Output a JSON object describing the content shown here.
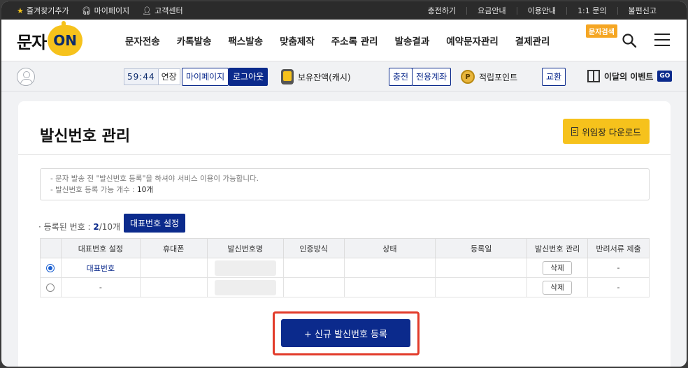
{
  "topbar": {
    "left": [
      "즐겨찾기추가",
      "마이페이지",
      "고객센터"
    ],
    "right": [
      "충전하기",
      "요금안내",
      "이용안내",
      "1:1 문의",
      "불편신고"
    ]
  },
  "header": {
    "logo_text": "문자",
    "logo_on": "ON",
    "nav": [
      "문자전송",
      "카톡발송",
      "팩스발송",
      "맞춤제작",
      "주소록 관리",
      "발송결과",
      "예약문자관리",
      "결제관리"
    ],
    "search_badge": "문자검색"
  },
  "userbar": {
    "timer": "59:44",
    "extend": "연장",
    "mypage": "마이페이지",
    "logout": "로그아웃",
    "balance": "보유잔액(캐시)",
    "charge": "충전",
    "dedicated": "전용계좌",
    "points": "적립포인트",
    "points_coin": "P",
    "exchange": "교환",
    "event": "이달의 이벤트",
    "go": "GO"
  },
  "page": {
    "title": "발신번호 관리",
    "download": "위임장 다운로드",
    "notice_1": "- 문자 발송 전 \"발신번호 등록\"을 하셔야 서비스 이용이 가능합니다.",
    "notice_2_prefix": "- 발신번호 등록 가능 개수 : ",
    "notice_2_value": "10개",
    "reg_prefix": "· 등록된 번호 : ",
    "reg_count": "2",
    "reg_suffix": "/10개",
    "rep_button": "대표번호 설정",
    "new_button": "+ 신규 발신번호 등록"
  },
  "table": {
    "headers": [
      "",
      "대표번호 설정",
      "휴대폰",
      "발신번호명",
      "인증방식",
      "상태",
      "등록일",
      "발신번호 관리",
      "반려서류 제출"
    ],
    "rows": [
      {
        "rep": "대표번호",
        "phone": "",
        "auth": "",
        "status": "",
        "date": "",
        "manage": "삭제",
        "doc": "-",
        "selected": true
      },
      {
        "rep": "-",
        "phone": "",
        "auth": "",
        "status": "",
        "date": "",
        "manage": "삭제",
        "doc": "-",
        "selected": false
      }
    ]
  }
}
